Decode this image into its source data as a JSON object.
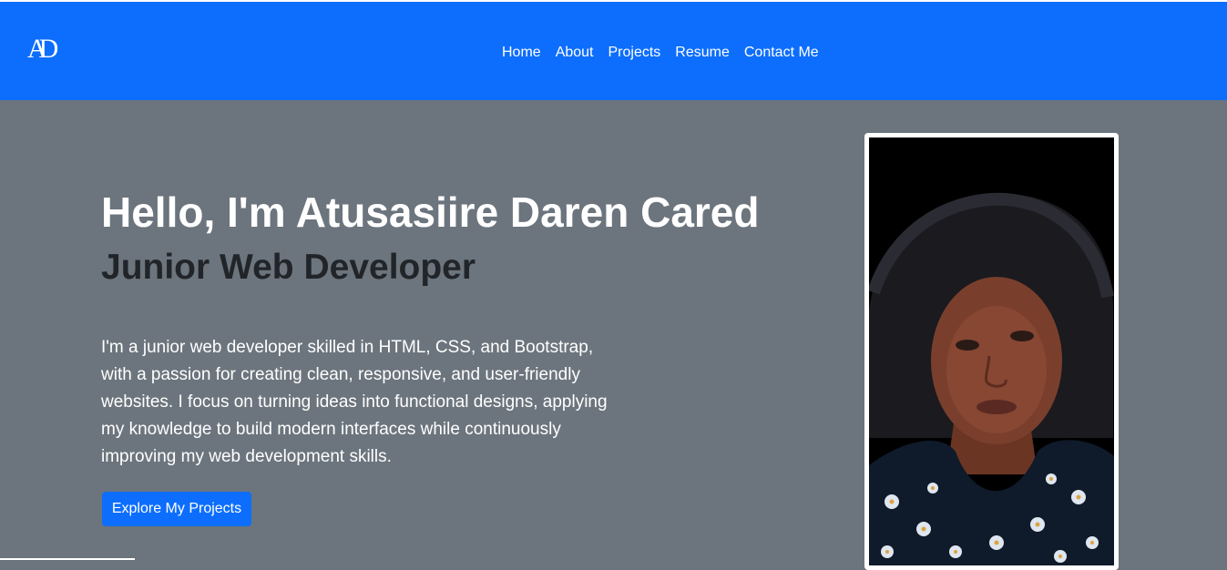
{
  "header": {
    "logo_text": "AD",
    "nav": [
      {
        "label": "Home"
      },
      {
        "label": "About"
      },
      {
        "label": "Projects"
      },
      {
        "label": "Resume"
      },
      {
        "label": "Contact Me"
      }
    ]
  },
  "hero": {
    "title": "Hello, I'm Atusasiire Daren Cared",
    "subtitle": "Junior Web Developer",
    "description": "I'm a junior web developer skilled in HTML, CSS, and Bootstrap, with a passion for creating clean, responsive, and user-friendly websites. I focus on turning ideas into functional designs, applying my knowledge to build modern interfaces while continuously improving my web development skills.",
    "cta_label": "Explore My Projects"
  },
  "colors": {
    "navbar": "#0d6efd",
    "page_background": "#6c757d",
    "button": "#0d6efd",
    "subtitle_text": "#212529"
  }
}
